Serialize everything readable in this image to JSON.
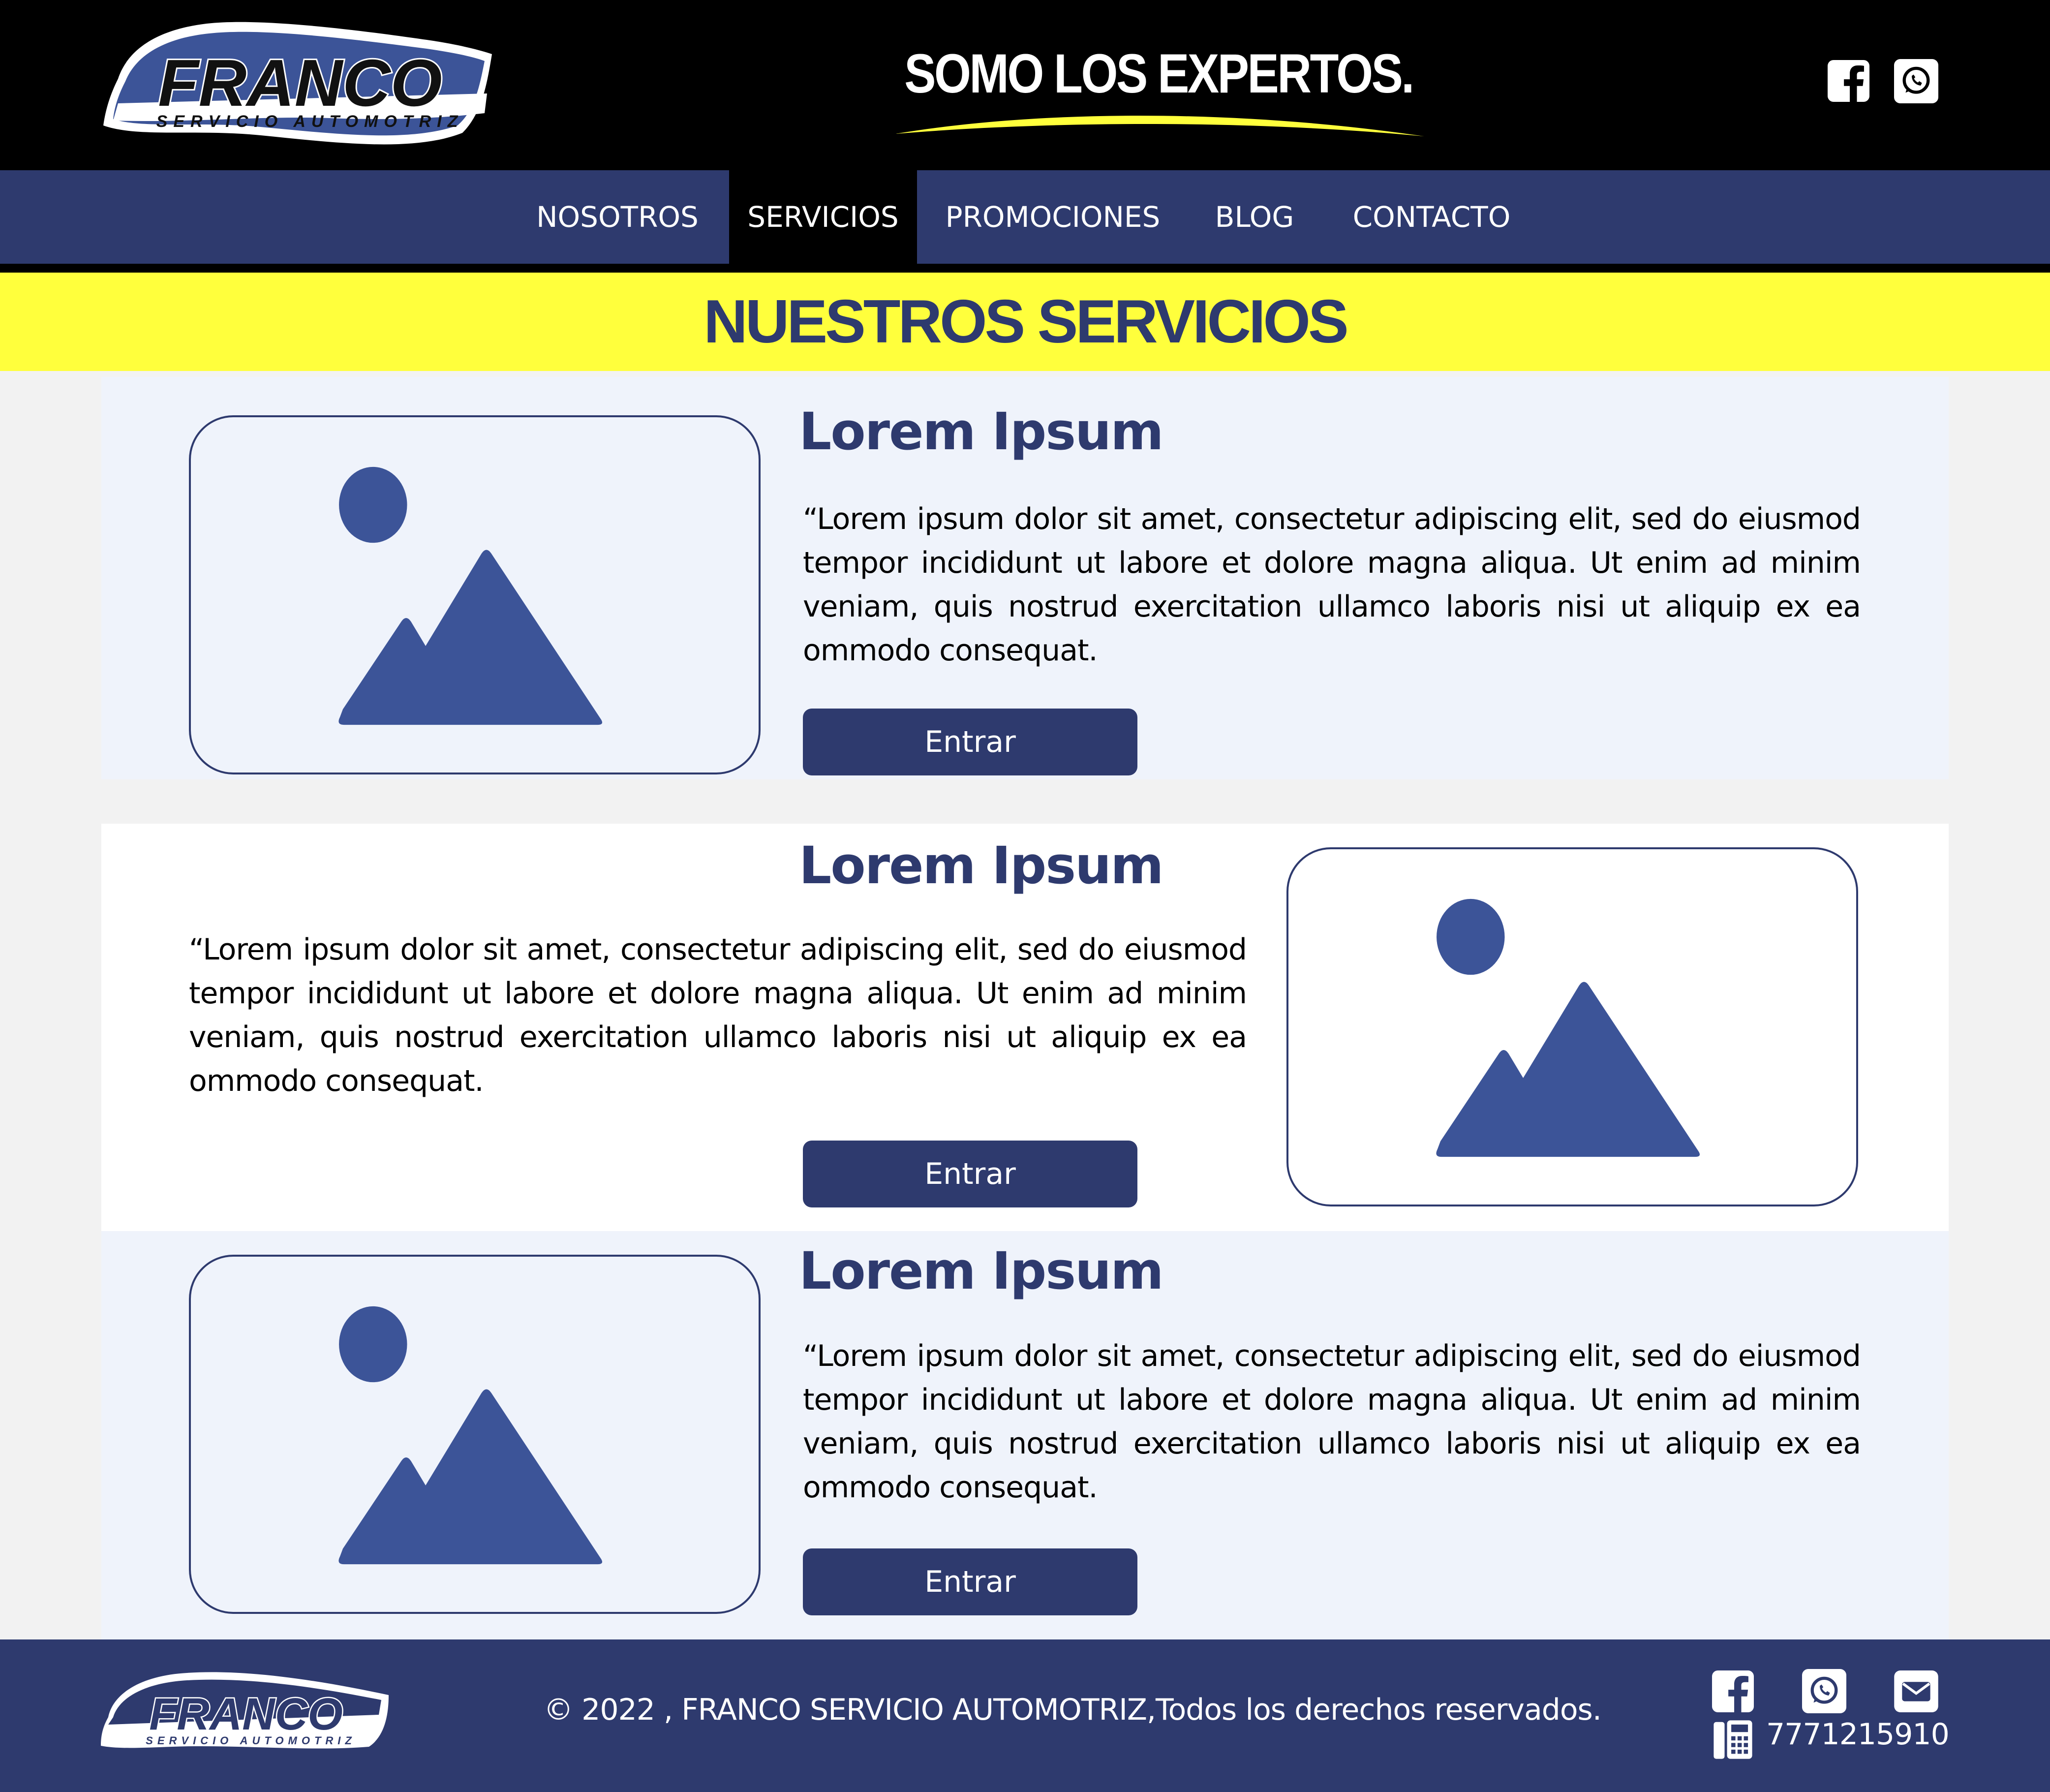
{
  "header": {
    "logo_main": "FRANCO",
    "logo_sub": "SERVICIO AUTOMOTRIZ",
    "tagline": "SOMO LOS EXPERTOS.",
    "social": [
      "facebook-icon",
      "whatsapp-icon"
    ]
  },
  "nav": {
    "items": [
      {
        "label": "NOSOTROS",
        "active": false
      },
      {
        "label": "SERVICIOS",
        "active": true
      },
      {
        "label": "PROMOCIONES",
        "active": false
      },
      {
        "label": "BLOG",
        "active": false
      },
      {
        "label": "CONTACTO",
        "active": false
      }
    ]
  },
  "page_title": "NUESTROS SERVICIOS",
  "services": [
    {
      "title": "Lorem Ipsum",
      "text": "“Lorem ipsum dolor sit amet, consectetur adipiscing elit, sed do eiusmod tempor incididunt ut labore et dolore magna aliqua. Ut enim ad minim veniam, quis nostrud exercitation ullamco laboris nisi ut aliquip ex ea ommodo consequat.",
      "button": "Entrar"
    },
    {
      "title": "Lorem Ipsum",
      "text": "“Lorem ipsum dolor sit amet, consectetur adipiscing elit, sed do eiusmod tempor incididunt ut labore et dolore magna aliqua. Ut enim ad minim veniam, quis nostrud exercitation ullamco laboris nisi ut aliquip ex ea ommodo consequat.",
      "button": "Entrar"
    },
    {
      "title": "Lorem Ipsum",
      "text": "“Lorem ipsum dolor sit amet, consectetur adipiscing elit, sed do eiusmod tempor incididunt ut labore et dolore magna aliqua. Ut enim ad minim veniam, quis nostrud exercitation ullamco laboris nisi ut aliquip ex ea ommodo consequat.",
      "button": "Entrar"
    }
  ],
  "footer": {
    "logo_main": "FRANCO",
    "logo_sub": "SERVICIO AUTOMOTRIZ",
    "copyright": "© 2022 , FRANCO SERVICIO AUTOMOTRIZ,Todos los derechos reservados.",
    "phone": "7771215910",
    "icons": [
      "facebook-icon",
      "whatsapp-icon",
      "mail-icon",
      "phone-icon"
    ]
  },
  "colors": {
    "navy": "#2e3a6e",
    "yellow": "#ffff3c",
    "black": "#000000",
    "image_placeholder_blue": "#3c5498",
    "section_tint": "#eff3fb"
  }
}
